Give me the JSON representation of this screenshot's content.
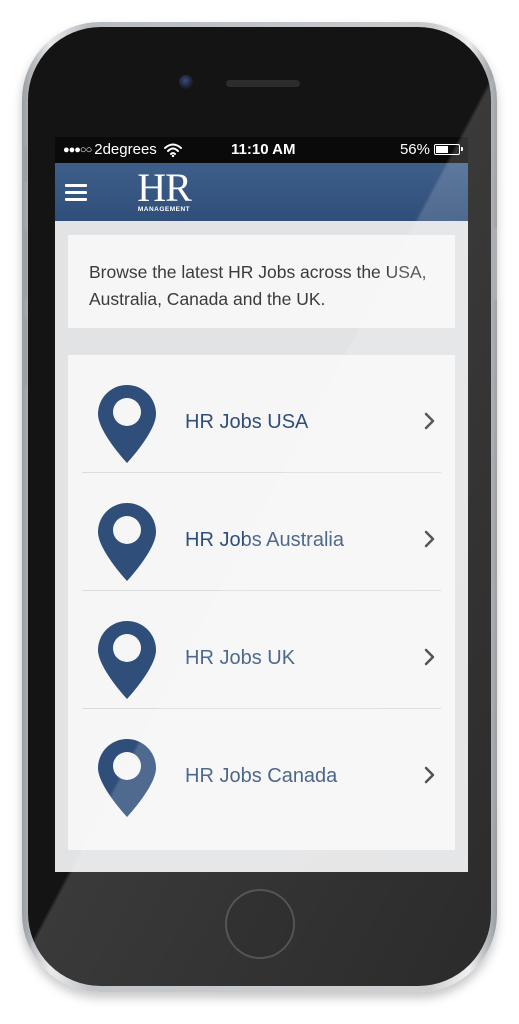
{
  "status_bar": {
    "signal": "●●●○○",
    "carrier": "2degrees",
    "time": "11:10 AM",
    "battery_percent": "56%",
    "battery_level": 0.56
  },
  "header": {
    "menu_icon": "hamburger-menu-icon",
    "logo_main": "HR",
    "logo_sub": "MANAGEMENT"
  },
  "intro": {
    "text": "Browse the latest HR Jobs across the USA, Australia, Canada and the UK."
  },
  "jobs": [
    {
      "label": "HR Jobs USA",
      "icon": "location-pin-icon"
    },
    {
      "label": "HR Jobs Australia",
      "icon": "location-pin-icon"
    },
    {
      "label": "HR Jobs UK",
      "icon": "location-pin-icon"
    },
    {
      "label": "HR Jobs Canada",
      "icon": "location-pin-icon"
    }
  ],
  "colors": {
    "brand_blue": "#2f4e7a",
    "header_top": "#3f5f8b",
    "card_bg": "#f6f6f6",
    "screen_bg": "#e2e3e4"
  }
}
